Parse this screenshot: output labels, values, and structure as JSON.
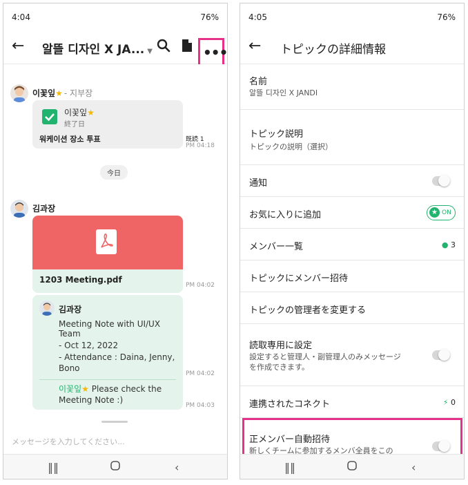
{
  "left": {
    "status_time": "4:04",
    "status_right": "76%",
    "title": "알뜰 디자인 X JA...",
    "messages": {
      "sender1_name": "이꽃잎",
      "sender1_role": "- 지부장",
      "poll_author": "이꽃잎",
      "poll_status": "終了日",
      "poll_title": "워케이션 장소 투표",
      "poll_read": "既読 1",
      "poll_time": "PM 04:18",
      "date_divider": "今日",
      "sender2_name": "김과장",
      "file_name": "1203 Meeting.pdf",
      "file_time": "PM 04:02",
      "reply_author": "김과장",
      "reply_line1": "Meeting Note with UI/UX Team",
      "reply_line2": "- Oct 12, 2022",
      "reply_line3": "- Attendance : Daina, Jenny, Bono",
      "reply_time": "PM 04:02",
      "mention_name": "이꽃잎",
      "mention_text": "Please check the Meeting Note :)",
      "mention_time": "PM 04:03"
    },
    "input_placeholder": "メッセージを入力してください..."
  },
  "right": {
    "status_time": "4:05",
    "status_right": "76%",
    "title": "トピックの詳細情報",
    "rows": {
      "name_label": "名前",
      "name_value": "알뜰 디자인 X JANDI",
      "desc_label": "トピック説明",
      "desc_value": "トピックの説明（選択）",
      "notify_label": "通知",
      "fav_label": "お気に入りに追加",
      "fav_state": "ON",
      "members_label": "メンバー一覧",
      "members_count": "3",
      "invite_label": "トピックにメンバー招待",
      "admin_label": "トピックの管理者を変更する",
      "readonly_label": "読取専用に設定",
      "readonly_desc": "設定すると管理人・副管理人のみメッセージを作成できます。",
      "connect_label": "連携されたコネクト",
      "connect_count": "0",
      "auto_label": "正メンバー自動招待",
      "auto_desc": "新しくチームに参加するメンバ全員をこの"
    }
  },
  "colors": {
    "accent_green": "#22b46e",
    "highlight_pink": "#e6318a",
    "pdf_red": "#ef6464"
  }
}
